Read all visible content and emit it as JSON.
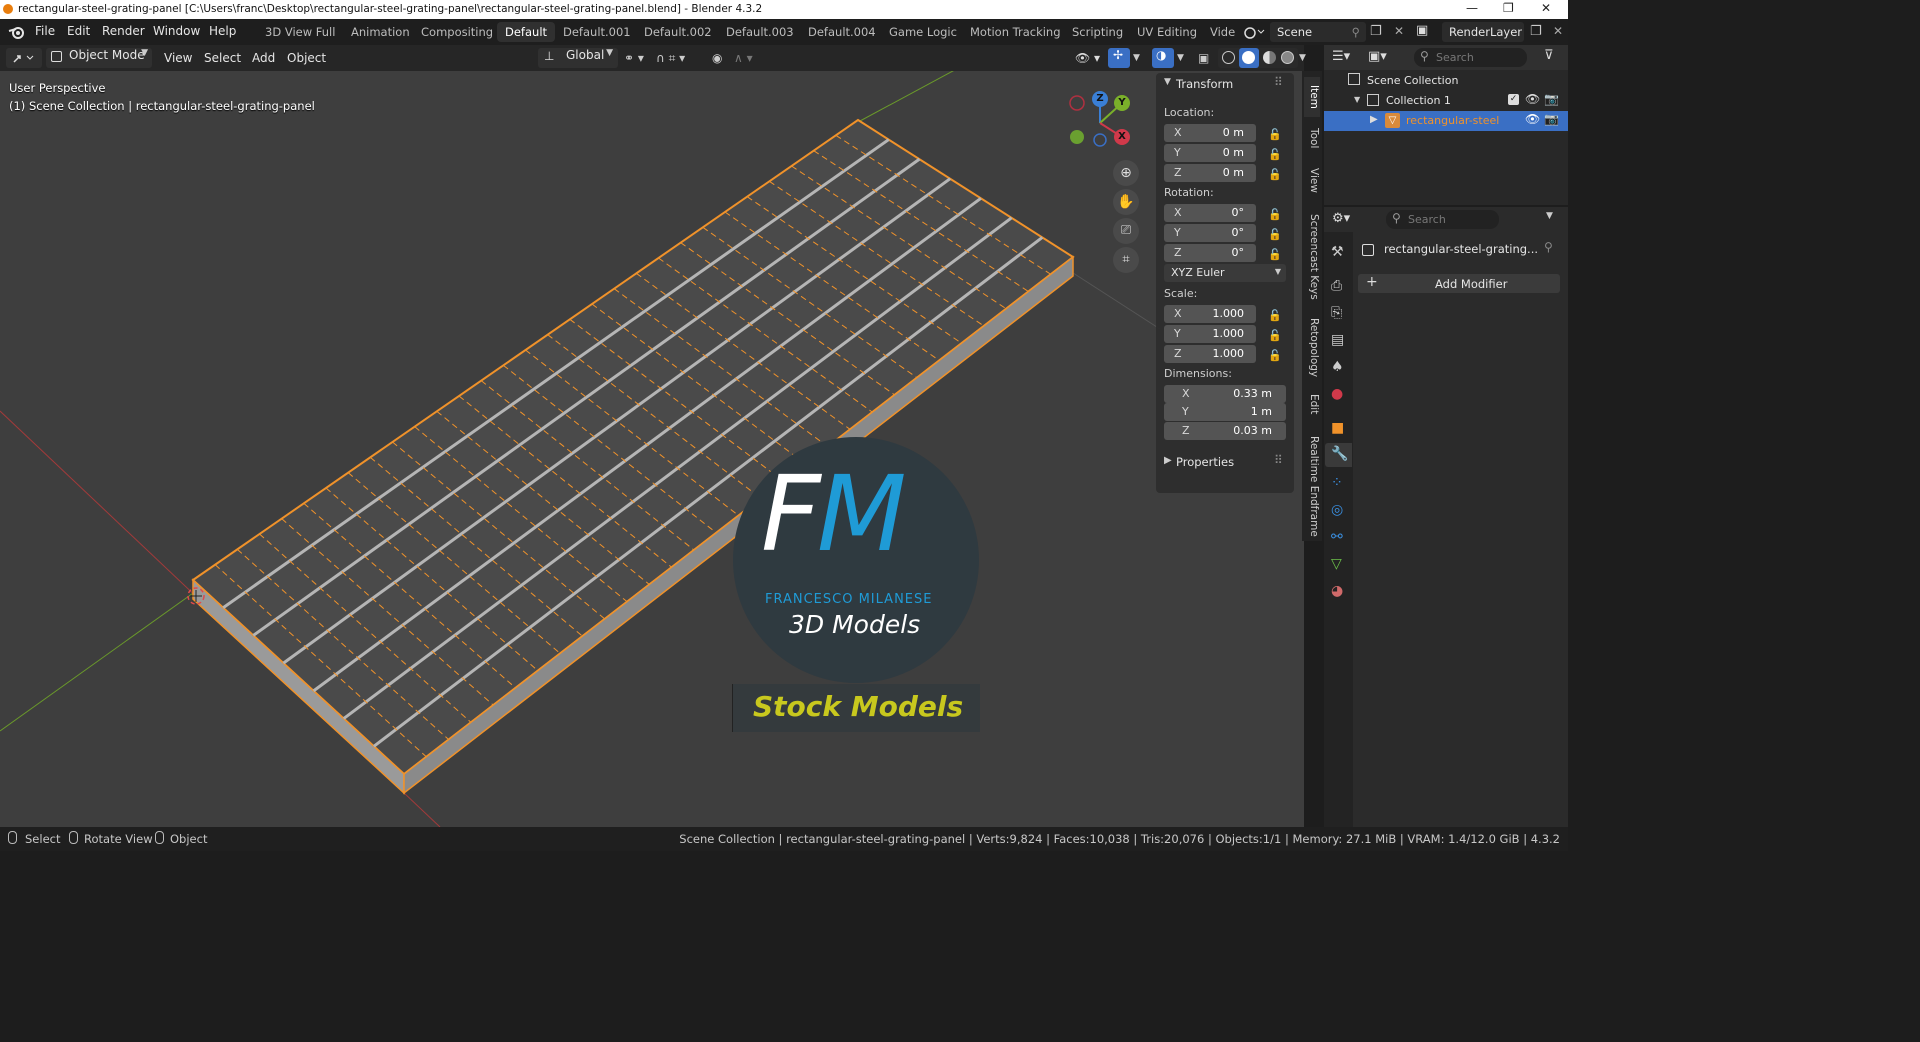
{
  "title_bar": {
    "text": "rectangular-steel-grating-panel [C:\\Users\\franc\\Desktop\\rectangular-steel-grating-panel\\rectangular-steel-grating-panel.blend] - Blender 4.3.2",
    "minimize": "—",
    "maximize": "❐",
    "close": "✕"
  },
  "menu": {
    "file": "File",
    "edit": "Edit",
    "render": "Render",
    "window": "Window",
    "help": "Help"
  },
  "workspaces": [
    "3D View Full",
    "Animation",
    "Compositing",
    "Default",
    "Default.001",
    "Default.002",
    "Default.003",
    "Default.004",
    "Game Logic",
    "Motion Tracking",
    "Scripting",
    "UV Editing",
    "Vide"
  ],
  "active_workspace": "Default",
  "scene": {
    "name": "Scene",
    "render_layer": "RenderLayer"
  },
  "viewport_header": {
    "mode": "Object Mode",
    "view": "View",
    "select": "Select",
    "add": "Add",
    "object": "Object",
    "orientation": "Global"
  },
  "viewport": {
    "perspective": "User Perspective",
    "collection_info": "(1) Scene Collection | rectangular-steel-grating-panel",
    "gizmo": {
      "z": "Z",
      "y": "Y",
      "x": "X"
    }
  },
  "watermark": {
    "letters": "FM",
    "name": "FRANCESCO MILANESE",
    "subtitle": "3D Models",
    "banner": "Stock Models"
  },
  "n_panel": {
    "transform_title": "Transform",
    "location_label": "Location:",
    "location": {
      "x": "0 m",
      "y": "0 m",
      "z": "0 m"
    },
    "rotation_label": "Rotation:",
    "rotation": {
      "x": "0°",
      "y": "0°",
      "z": "0°"
    },
    "rotation_mode": "XYZ Euler",
    "scale_label": "Scale:",
    "scale": {
      "x": "1.000",
      "y": "1.000",
      "z": "1.000"
    },
    "dimensions_label": "Dimensions:",
    "dimensions": {
      "x": "0.33 m",
      "y": "1 m",
      "z": "0.03 m"
    },
    "properties_title": "Properties",
    "axis": {
      "x": "X",
      "y": "Y",
      "z": "Z"
    }
  },
  "side_tabs": [
    "Item",
    "Tool",
    "View",
    "Screencast Keys",
    "Retopology",
    "Edit",
    "Realtime Endframe"
  ],
  "outliner": {
    "search_placeholder": "Search",
    "scene_collection": "Scene Collection",
    "collection": "Collection 1",
    "object": "rectangular-steel"
  },
  "properties": {
    "search_placeholder": "Search",
    "object_name": "rectangular-steel-grating...",
    "add_modifier": "Add Modifier"
  },
  "status_bar": {
    "select": "Select",
    "rotate": "Rotate View",
    "object": "Object",
    "stats": "Scene Collection | rectangular-steel-grating-panel | Verts:9,824 | Faces:10,038 | Tris:20,076 | Objects:1/1 | Memory: 27.1 MiB | VRAM: 1.4/12.0 GiB | 4.3.2"
  },
  "colors": {
    "accent_orange": "#f0922a",
    "active_blue": "#3a6fc4",
    "fm_blue": "#1f9bd6",
    "banner_yellow": "#c8c81e"
  }
}
